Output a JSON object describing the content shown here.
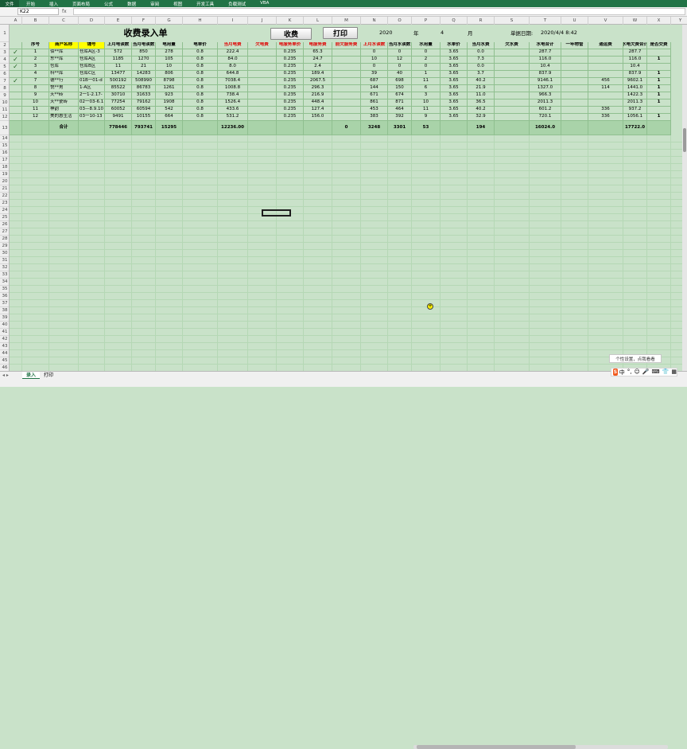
{
  "ribbon": {
    "file": "文件",
    "tabs": [
      "开始",
      "插入",
      "页面布局",
      "公式",
      "数据",
      "审阅",
      "视图",
      "开发工具",
      "负载测试",
      "VBA"
    ]
  },
  "formula_bar": {
    "name_box": "K22",
    "fx": "fx",
    "value": ""
  },
  "columns": [
    "A",
    "B",
    "C",
    "D",
    "E",
    "F",
    "G",
    "H",
    "I",
    "J",
    "K",
    "L",
    "M",
    "N",
    "O",
    "P",
    "Q",
    "R",
    "S",
    "T",
    "U",
    "V",
    "W",
    "X",
    "Y"
  ],
  "sheet": {
    "title": "收费录入单",
    "collect_button": "收费",
    "print_button": "打印",
    "year": "2020",
    "year_label": "年",
    "month": "4",
    "month_label": "月",
    "print_date_label": "单据日期:",
    "print_date": "2020/4/4 8:42",
    "headers": [
      "序号",
      "商户名称",
      "铺号",
      "上月电读数",
      "当月电读数",
      "电用量",
      "电单价",
      "当月电费",
      "欠电费",
      "电服务单价",
      "电服务费",
      "前欠服务费",
      "上月水读数",
      "当月水读数",
      "水用量",
      "水单价",
      "当月水费",
      "欠水费",
      "水电合计",
      "一年物管",
      "通运费",
      "水电欠费合计",
      "是否交费"
    ],
    "rows": [
      {
        "check": "✓",
        "c": [
          "1",
          "佰**库",
          "仓库A区-3",
          "572",
          "850",
          "278",
          "0.8",
          "222.4",
          "",
          "0.235",
          "65.3",
          "",
          "0",
          "0",
          "0",
          "3.65",
          "0.0",
          "",
          "287.7",
          "",
          "",
          "287.7",
          ""
        ]
      },
      {
        "check": "✓",
        "c": [
          "2",
          "东**库",
          "仓库A区",
          "1185",
          "1270",
          "105",
          "0.8",
          "84.0",
          "",
          "0.235",
          "24.7",
          "",
          "10",
          "12",
          "2",
          "3.65",
          "7.3",
          "",
          "116.0",
          "",
          "",
          "116.0",
          "1"
        ]
      },
      {
        "check": "✓",
        "c": [
          "3",
          "仓库",
          "仓库B区",
          "11",
          "21",
          "10",
          "0.8",
          "8.0",
          "",
          "0.235",
          "2.4",
          "",
          "0",
          "0",
          "0",
          "3.65",
          "0.0",
          "",
          "10.4",
          "",
          "",
          "10.4",
          ""
        ]
      },
      {
        "check": "",
        "c": [
          "4",
          "科**库",
          "仓库C区",
          "13477",
          "14283",
          "806",
          "0.8",
          "644.8",
          "",
          "0.235",
          "189.4",
          "",
          "39",
          "40",
          "1",
          "3.65",
          "3.7",
          "",
          "837.9",
          "",
          "",
          "837.9",
          "1"
        ]
      },
      {
        "check": "✓",
        "c": [
          "7",
          "德**行",
          "01B一01-d",
          "500192",
          "508990",
          "8798",
          "0.8",
          "7038.4",
          "",
          "0.235",
          "2067.5",
          "",
          "687",
          "698",
          "11",
          "3.65",
          "40.2",
          "",
          "9146.1",
          "",
          "456",
          "9602.1",
          "1"
        ]
      },
      {
        "check": "",
        "c": [
          "8",
          "悦**男",
          "1-A区",
          "85522",
          "86783",
          "1261",
          "0.8",
          "1008.8",
          "",
          "0.235",
          "296.3",
          "",
          "144",
          "150",
          "6",
          "3.65",
          "21.9",
          "",
          "1327.0",
          "",
          "114",
          "1441.0",
          "1"
        ]
      },
      {
        "check": "",
        "c": [
          "9",
          "天**砖",
          "2一1-2.17-",
          "30710",
          "31633",
          "923",
          "0.8",
          "738.4",
          "",
          "0.235",
          "216.9",
          "",
          "671",
          "674",
          "3",
          "3.65",
          "11.0",
          "",
          "966.3",
          "",
          "",
          "1422.3",
          "1"
        ]
      },
      {
        "check": "",
        "c": [
          "10",
          "天**瓷砖",
          "02一03-6.1",
          "77254",
          "79162",
          "1908",
          "0.8",
          "1526.4",
          "",
          "0.235",
          "448.4",
          "",
          "861",
          "871",
          "10",
          "3.65",
          "36.5",
          "",
          "2011.3",
          "",
          "",
          "2011.3",
          "1"
        ]
      },
      {
        "check": "",
        "c": [
          "11",
          "神韵",
          "03—8.9.10",
          "60052",
          "60594",
          "542",
          "0.8",
          "433.6",
          "",
          "0.235",
          "127.4",
          "",
          "453",
          "464",
          "11",
          "3.65",
          "40.2",
          "",
          "601.2",
          "",
          "336",
          "937.2",
          ""
        ]
      },
      {
        "check": "",
        "c": [
          "12",
          "美的惠生活",
          "03一10-13",
          "9491",
          "10155",
          "664",
          "0.8",
          "531.2",
          "",
          "0.235",
          "156.0",
          "",
          "383",
          "392",
          "9",
          "3.65",
          "32.9",
          "",
          "720.1",
          "",
          "336",
          "1056.1",
          "1"
        ]
      }
    ],
    "total": {
      "label": "合计",
      "c": [
        "",
        "",
        "",
        "778446",
        "793741",
        "15295",
        "",
        "12236.00",
        "",
        "",
        "",
        "0",
        "3248",
        "3301",
        "53",
        "",
        "194",
        "",
        "16024.0",
        "",
        "",
        "17722.0",
        ""
      ]
    },
    "row_numbers": [
      "1",
      "2",
      "3",
      "4",
      "5",
      "6",
      "7",
      "8",
      "9",
      "10",
      "11",
      "12",
      "13",
      "14",
      "15",
      "16",
      "17",
      "18",
      "19",
      "20",
      "21",
      "22",
      "23",
      "24",
      "25",
      "26",
      "27",
      "28",
      "29",
      "30",
      "31",
      "32",
      "33",
      "34",
      "35",
      "36",
      "37",
      "38",
      "39",
      "40",
      "41",
      "42",
      "43",
      "44",
      "45",
      "46"
    ]
  },
  "sheet_tabs": [
    "录入",
    "打印"
  ],
  "ime": {
    "tip": "个性设置，点我看看",
    "logo": "S",
    "items": [
      "中",
      "°,",
      "☺",
      "🎤",
      "⌨",
      "👕",
      "▦"
    ]
  },
  "colors": {
    "ribbon": "#217346",
    "grid_bg": "#c9e2c9",
    "header_red": "#e00000",
    "yellow": "#ffff00"
  }
}
